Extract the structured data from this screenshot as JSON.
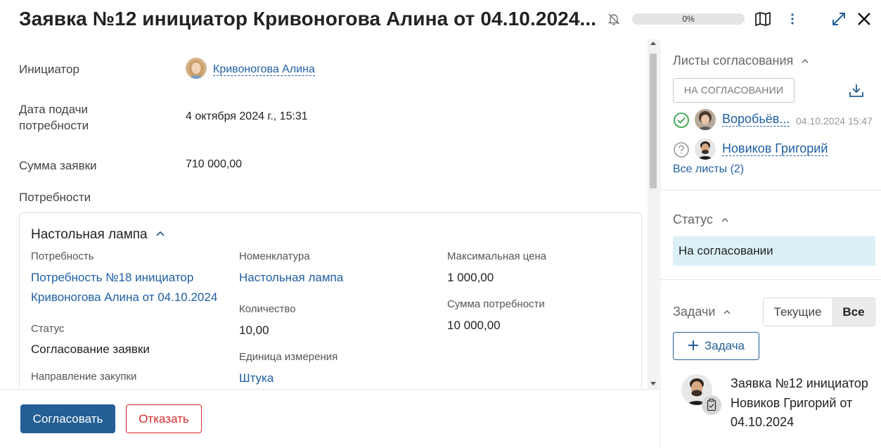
{
  "header": {
    "title": "Заявка №12 инициатор Кривоногова Алина от 04.10.2024...",
    "progress_text": "0%",
    "progress_value": 0
  },
  "details": {
    "initiator_label": "Инициатор",
    "initiator_name": "Кривоногова Алина",
    "date_label": "Дата подачи потребности",
    "date_value": "4 октября 2024 г., 15:31",
    "sum_label": "Сумма заявки",
    "sum_value": "710 000,00",
    "needs_label": "Потребности"
  },
  "need_card": {
    "title": "Настольная лампа",
    "need_label": "Потребность",
    "need_value": "Потребность №18 инициатор Кривоногова Алина от 04.10.2024",
    "nomenclature_label": "Номенклатура",
    "nomenclature_value": "Настольная лампа",
    "max_price_label": "Максимальная цена",
    "max_price_value": "1 000,00",
    "quantity_label": "Количество",
    "quantity_value": "10,00",
    "need_sum_label": "Сумма потребности",
    "need_sum_value": "10 000,00",
    "status_label": "Статус",
    "status_value": "Согласование заявки",
    "unit_label": "Единица измерения",
    "unit_value": "Штука",
    "direction_label": "Направление закупки"
  },
  "footer": {
    "approve_label": "Согласовать",
    "reject_label": "Отказать"
  },
  "approvals": {
    "title": "Листы согласования",
    "badge": "НА СОГЛАСОВАНИИ",
    "items": [
      {
        "name": "Воробьёв...",
        "date": "04.10.2024 15:47",
        "state": "approved"
      },
      {
        "name": "Новиков Григорий",
        "date": "",
        "state": "pending"
      }
    ],
    "all_link": "Все листы (2)"
  },
  "status": {
    "title": "Статус",
    "value": "На согласовании"
  },
  "tasks": {
    "title": "Задачи",
    "tab_current": "Текущие",
    "tab_all": "Все",
    "add_label": "Задача",
    "item_text": "Заявка №12 инициатор Новиков Григорий от 04.10.2024"
  },
  "colors": {
    "primary": "#245f96",
    "link": "#1f5fa3",
    "danger": "#d42b2b",
    "status_bg": "#dcf0f8",
    "approved_green": "#3aa64a"
  }
}
